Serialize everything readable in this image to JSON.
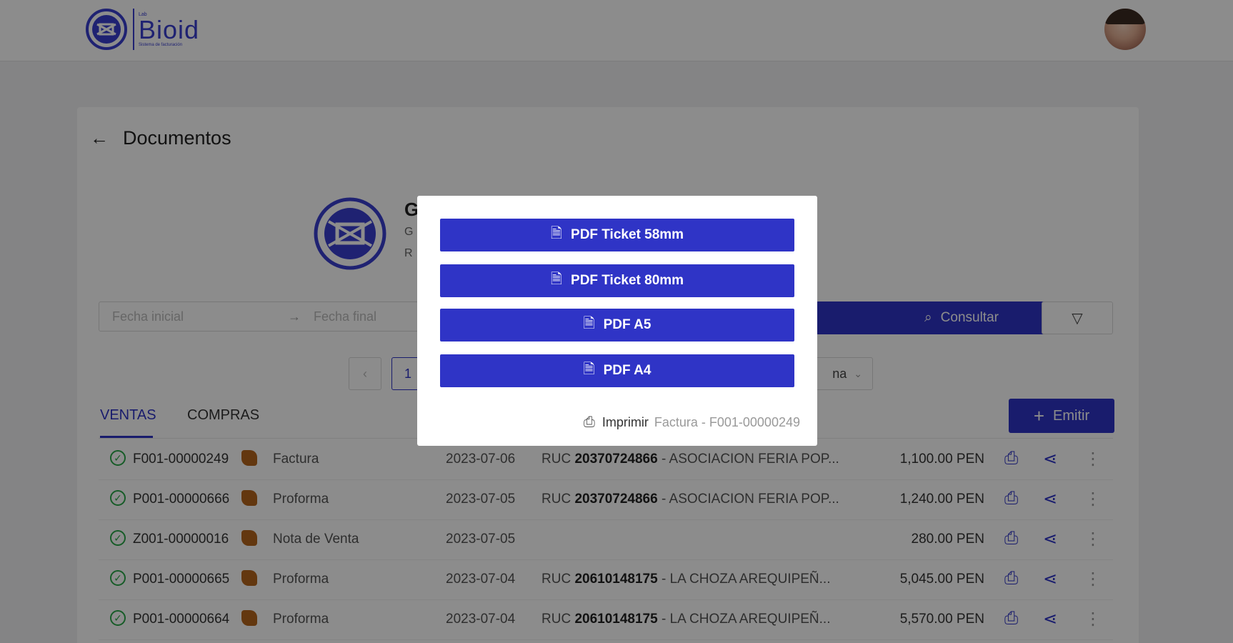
{
  "header": {
    "logo_small": "Lab",
    "logo_name": "Bioid",
    "logo_tag": "Sistema de facturación"
  },
  "page": {
    "title": "Documentos"
  },
  "company": {
    "name": "G",
    "line2": "G",
    "line3": "R"
  },
  "filters": {
    "date_start_placeholder": "Fecha inicial",
    "date_end_placeholder": "Fecha final",
    "search_label": "Consultar"
  },
  "pager": {
    "current_page": "1",
    "page_size_label": "na"
  },
  "tabs": [
    {
      "label": "VENTAS",
      "active": true
    },
    {
      "label": "COMPRAS",
      "active": false
    }
  ],
  "emit_label": "Emitir",
  "rows": [
    {
      "numero": "F001-00000249",
      "tipo": "Factura",
      "fecha": "2023-07-06",
      "cliente_pre": "RUC",
      "cliente_id": "20370724866",
      "cliente_name": "- ASOCIACION FERIA POP...",
      "monto": "1,100.00 PEN"
    },
    {
      "numero": "P001-00000666",
      "tipo": "Proforma",
      "fecha": "2023-07-05",
      "cliente_pre": "RUC",
      "cliente_id": "20370724866",
      "cliente_name": "- ASOCIACION FERIA POP...",
      "monto": "1,240.00 PEN"
    },
    {
      "numero": "Z001-00000016",
      "tipo": "Nota de Venta",
      "fecha": "2023-07-05",
      "cliente_pre": "",
      "cliente_id": "",
      "cliente_name": "",
      "monto": "280.00 PEN"
    },
    {
      "numero": "P001-00000665",
      "tipo": "Proforma",
      "fecha": "2023-07-04",
      "cliente_pre": "RUC",
      "cliente_id": "20610148175",
      "cliente_name": "- LA CHOZA AREQUIPEÑ...",
      "monto": "5,045.00 PEN"
    },
    {
      "numero": "P001-00000664",
      "tipo": "Proforma",
      "fecha": "2023-07-04",
      "cliente_pre": "RUC",
      "cliente_id": "20610148175",
      "cliente_name": "- LA CHOZA AREQUIPEÑ...",
      "monto": "5,570.00 PEN"
    }
  ],
  "modal": {
    "buttons": [
      "PDF Ticket 58mm",
      "PDF Ticket 80mm",
      "PDF A5",
      "PDF A4"
    ],
    "footer_label": "Imprimir",
    "footer_doc": "Factura - F001-00000249"
  },
  "colors": {
    "accent": "#2f34c6",
    "success": "#2aa84a"
  }
}
